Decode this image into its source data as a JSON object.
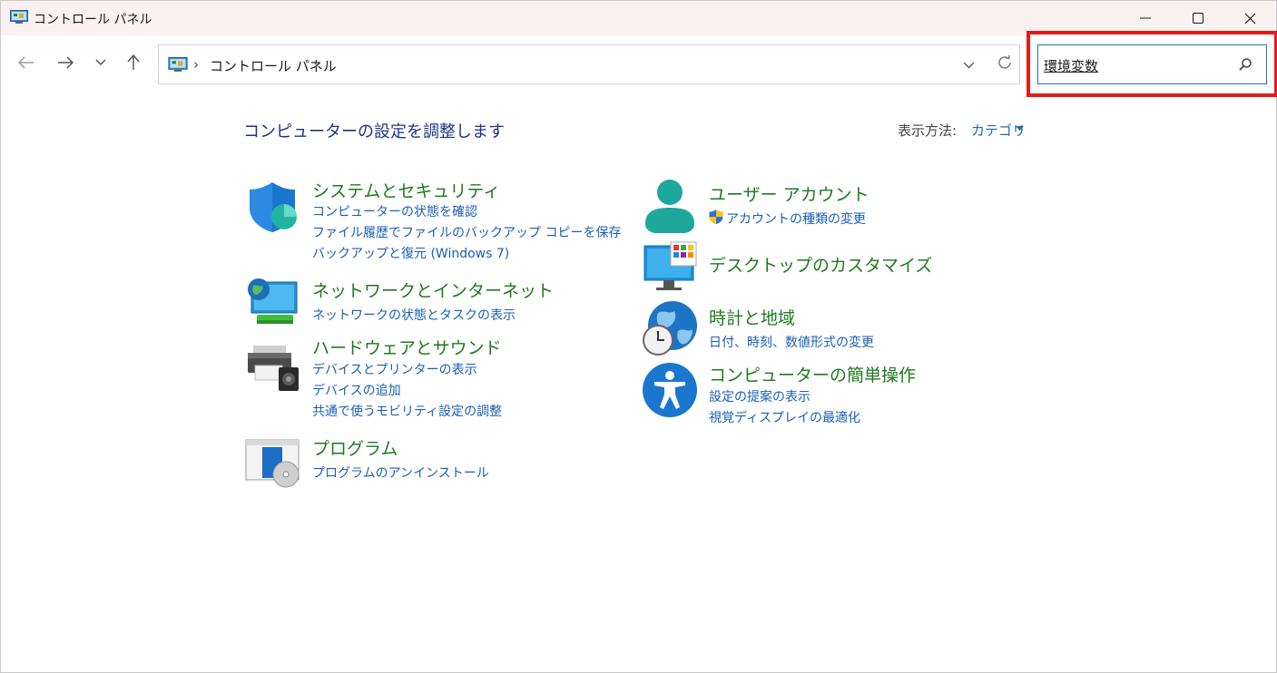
{
  "window": {
    "title": "コントロール パネル"
  },
  "nav": {
    "address": "コントロール パネル",
    "search_value": "環境変数"
  },
  "main": {
    "page_title": "コンピューターの設定を調整します",
    "view_by_label": "表示方法:",
    "view_by_value": "カテゴリ"
  },
  "categories": {
    "system": {
      "title": "システムとセキュリティ",
      "links": [
        "コンピューターの状態を確認",
        "ファイル履歴でファイルのバックアップ コピーを保存",
        "バックアップと復元 (Windows 7)"
      ]
    },
    "network": {
      "title": "ネットワークとインターネット",
      "links": [
        "ネットワークの状態とタスクの表示"
      ]
    },
    "hardware": {
      "title": "ハードウェアとサウンド",
      "links": [
        "デバイスとプリンターの表示",
        "デバイスの追加",
        "共通で使うモビリティ設定の調整"
      ]
    },
    "programs": {
      "title": "プログラム",
      "links": [
        "プログラムのアンインストール"
      ]
    },
    "users": {
      "title": "ユーザー アカウント",
      "links": [
        "アカウントの種類の変更"
      ]
    },
    "desktop": {
      "title": "デスクトップのカスタマイズ",
      "links": []
    },
    "clock": {
      "title": "時計と地域",
      "links": [
        "日付、時刻、数値形式の変更"
      ]
    },
    "access": {
      "title": "コンピューターの簡単操作",
      "links": [
        "設定の提案の表示",
        "視覚ディスプレイの最適化"
      ]
    }
  },
  "colors": {
    "category_title": "#1e7a1e",
    "link": "#1a5fb4",
    "highlight": "#e01d1d"
  }
}
